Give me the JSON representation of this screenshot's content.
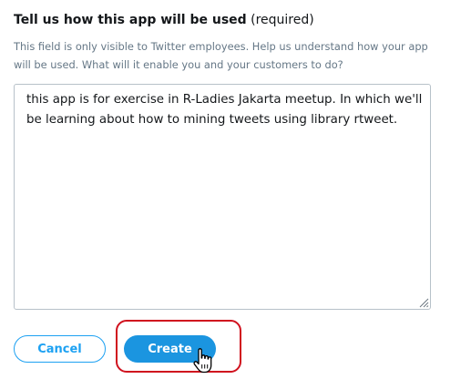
{
  "field": {
    "label": "Tell us how this app will be used",
    "required": "(required)",
    "help": "This field is only visible to Twitter employees. Help us understand how your app will be used. What will it enable you and your customers to do?",
    "value": "this app is for exercise in R-Ladies Jakarta meetup. In which we'll be learning about how to mining tweets using library rtweet."
  },
  "actions": {
    "cancel_label": "Cancel",
    "create_label": "Create"
  },
  "colors": {
    "accent": "#1da1f2",
    "create_bg": "#1b95e0",
    "highlight": "#d0111e",
    "help_text": "#657786"
  },
  "icons": {
    "resize": "resize-grip-icon",
    "cursor": "hand-pointer-icon"
  }
}
